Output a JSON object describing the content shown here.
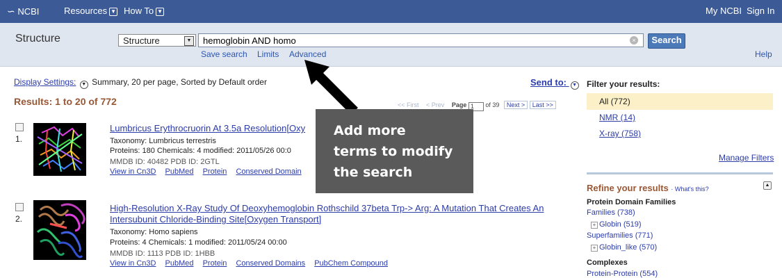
{
  "topbar": {
    "logo": "NCBI",
    "resources": "Resources",
    "howto": "How To",
    "my_ncbi": "My NCBI",
    "sign_in": "Sign In"
  },
  "search": {
    "db_title": "Structure",
    "db_selected": "Structure",
    "query": "hemoglobin AND homo",
    "button": "Search",
    "save_search": "Save search",
    "limits": "Limits",
    "advanced": "Advanced",
    "help": "Help"
  },
  "results_header": {
    "display_settings": "Display Settings:",
    "display_summary": "Summary, 20 per page, Sorted by Default order",
    "send_to": "Send to:",
    "count": "Results: 1 to 20 of 772",
    "pager_first": "<< First",
    "pager_prev": "< Prev",
    "pager_page_label": "Page",
    "pager_page": "1",
    "pager_of": "of 39",
    "pager_next": "Next >",
    "pager_last": "Last >>"
  },
  "results": [
    {
      "num": "1.",
      "title": "Lumbricus Erythrocruorin At 3.5a Resolution[Oxy",
      "taxonomy": "Taxonomy: Lumbricus terrestris",
      "stats": "Proteins: 180  Chemicals: 4  modified: 2011/05/26 00:0",
      "ids": "MMDB ID: 40482  PDB ID: 2GTL",
      "links": [
        "View in Cn3D",
        "PubMed",
        "Protein",
        "Conserved Domain"
      ]
    },
    {
      "num": "2.",
      "title_line1": "High-Resolution X-Ray Study Of Deoxyhemoglobin Rothschild 37beta Trp-> Arg: A Mutation That Creates An",
      "title_line2": "Intersubunit Chloride-Binding Site[Oxygen Transport]",
      "taxonomy": "Taxonomy: Homo sapiens",
      "stats": "Proteins: 4  Chemicals: 1  modified: 2011/05/24 00:00",
      "ids": "MMDB ID: 1113  PDB ID: 1HBB",
      "links": [
        "View in Cn3D",
        "PubMed",
        "Protein",
        "Conserved Domains",
        "PubChem Compound"
      ]
    }
  ],
  "filters": {
    "heading": "Filter your results:",
    "all": "All (772)",
    "nmr": "NMR (14)",
    "xray": "X-ray (758)",
    "manage": "Manage Filters"
  },
  "refine": {
    "title": "Refine your results",
    "whats_this": "What's this?",
    "pdf_heading": "Protein Domain Families",
    "families": "Families (738)",
    "globin": "Globin (519)",
    "superfamilies": "Superfamilies (771)",
    "globin_like": "Globin_like (570)",
    "complexes": "Complexes",
    "protein_protein": "Protein-Protein (554)"
  },
  "callout": {
    "line1": "Add more",
    "line2": "terms to modify",
    "line3": "the search"
  },
  "colors": {
    "topbar": "#3c5a95",
    "searchband": "#dfe6ef",
    "results_title": "#985735",
    "link": "#2b3ba8",
    "callout": "#5a5a5a"
  }
}
